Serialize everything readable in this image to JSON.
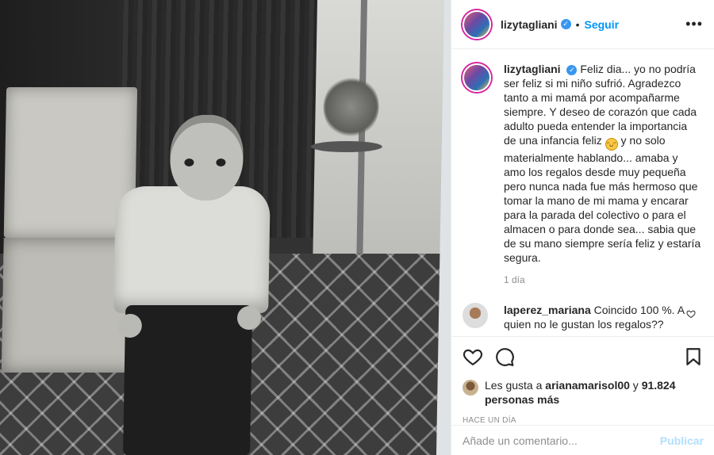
{
  "post": {
    "username": "lizytagliani",
    "follow_label": "Seguir",
    "separator": "•",
    "more_icon": "more-options-icon"
  },
  "caption": {
    "username": "lizytagliani",
    "text_before_emoji": "Feliz dia... yo no podría ser feliz si mi niño sufrió. Agradezco tanto a mi mamá por acompañarme siempre. Y deseo de corazón que cada adulto pueda entender la importancia de una infancia feliz",
    "emoji": "grinning-face",
    "text_after_emoji": "y no solo materialmente hablando... amaba y amo los regalos desde muy pequeña pero nunca nada fue más hermoso que tomar la mano de mi mama y encarar para la parada del colectivo o para el almacen o para donde sea... sabia que de su mano siempre sería feliz y estaría segura.",
    "time": "1 día"
  },
  "comment": {
    "username": "laperez_mariana",
    "text": "Coincido 100 %. A quien no le gustan los regalos??"
  },
  "likes": {
    "prefix": "Les gusta a",
    "liker": "arianamarisol00",
    "joiner": "y",
    "count": "91.824 personas más"
  },
  "posted_ago": "HACE UN DÍA",
  "add_comment": {
    "placeholder": "Añade un comentario...",
    "submit_label": "Publicar"
  },
  "colors": {
    "accent": "#0095f6",
    "verified": "#3897f0",
    "muted": "#8e8e8e",
    "submit_disabled": "#b2dffc"
  }
}
